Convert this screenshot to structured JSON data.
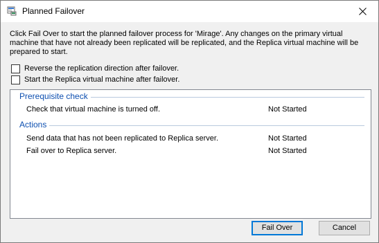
{
  "window": {
    "title": "Planned Failover"
  },
  "description": "Click Fail Over to start the planned failover process for 'Mirage'. Any changes on the primary virtual machine that have not already been replicated will be replicated, and the Replica virtual machine will be prepared to start.",
  "options": [
    {
      "label": "Reverse the replication direction after failover.",
      "checked": false
    },
    {
      "label": "Start the Replica virtual machine after failover.",
      "checked": false
    }
  ],
  "sections": [
    {
      "title": "Prerequisite check",
      "steps": [
        {
          "label": "Check that virtual machine is turned off.",
          "status": "Not Started"
        }
      ]
    },
    {
      "title": "Actions",
      "steps": [
        {
          "label": "Send data that has not been replicated to Replica server.",
          "status": "Not Started"
        },
        {
          "label": "Fail over to Replica server.",
          "status": "Not Started"
        }
      ]
    }
  ],
  "buttons": {
    "fail_over": "Fail Over",
    "cancel": "Cancel"
  },
  "colors": {
    "section_title": "#0d4fb0",
    "default_button_border": "#0078d7",
    "panel_border": "#828790"
  },
  "icons": {
    "app": "hyper-v-manager-icon",
    "close": "close-icon"
  }
}
